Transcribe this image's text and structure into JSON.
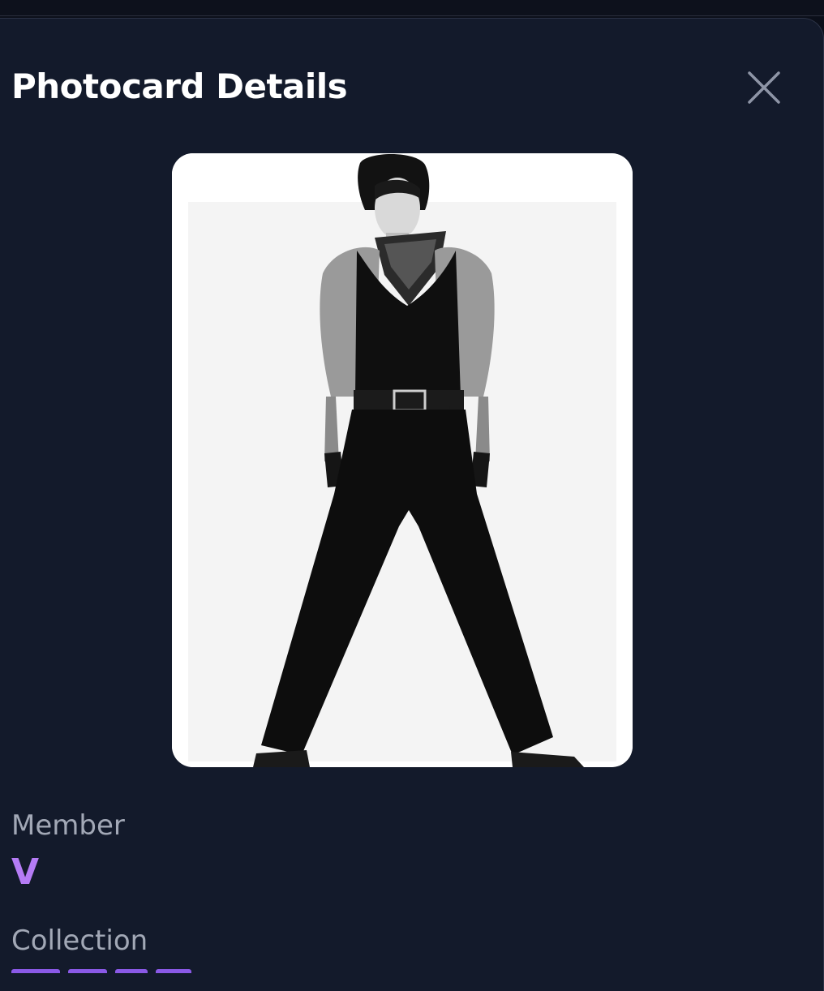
{
  "modal": {
    "title": "Photocard Details",
    "close_icon": "close-icon"
  },
  "photocard": {
    "image_description_icon": "photo-image"
  },
  "details": {
    "member_label": "Member",
    "member_value": "V",
    "collection_label": "Collection"
  },
  "colors": {
    "background": "#131a2b",
    "accent": "#b57cf5",
    "label": "#a2a8b6",
    "title": "#ffffff"
  }
}
